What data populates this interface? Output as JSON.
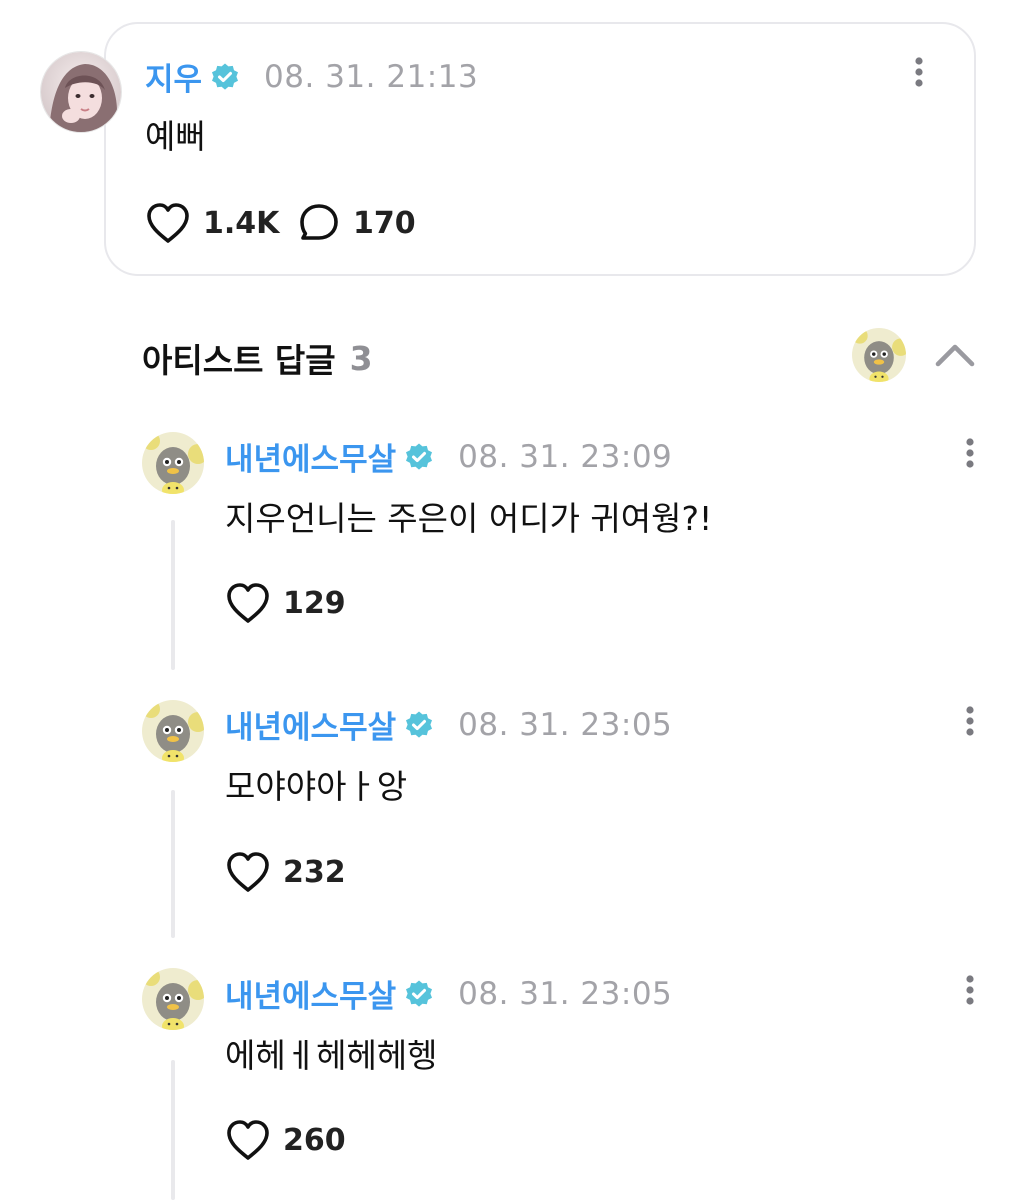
{
  "post": {
    "author": "지우",
    "verified": true,
    "timestamp": "08. 31. 21:13",
    "text": "예뻐",
    "likes": "1.4K",
    "comments": "170",
    "avatar_icon": "profile-photo"
  },
  "artist_replies": {
    "title": "아티스트 답글",
    "count": "3",
    "avatar_icon": "duck-character-avatar",
    "collapse_icon": "chevron-up-icon"
  },
  "replies": [
    {
      "author": "내년에스무살",
      "timestamp": "08. 31. 23:09",
      "text": "지우언니는 주은이 어디가 귀여웡?!",
      "likes": "129"
    },
    {
      "author": "내년에스무살",
      "timestamp": "08. 31. 23:05",
      "text": "모야야아ㅏ앙",
      "likes": "232"
    },
    {
      "author": "내년에스무살",
      "timestamp": "08. 31. 23:05",
      "text": "에헤ㅔ헤헤헤헹",
      "likes": "260"
    }
  ],
  "colors": {
    "author_name": "#3b96ef",
    "verified_badge": "#56c3db",
    "timestamp": "#a3a3a8",
    "card_border": "#e8e8ec",
    "reply_count": "#8f8f94",
    "thread_line": "#e9e9ec"
  }
}
